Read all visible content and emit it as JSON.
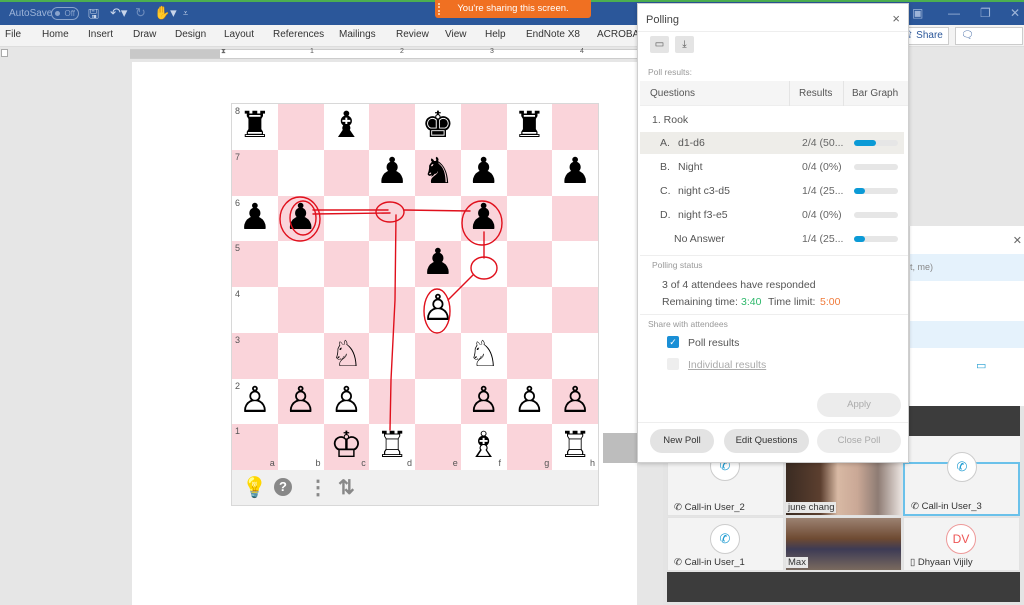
{
  "titlebar": {
    "autosave_label": "AutoSave",
    "autosave_state": "Off",
    "quick_access_icons": [
      "save-icon",
      "undo-icon",
      "redo-icon",
      "touch-mode-icon",
      "customize-icon"
    ],
    "sharing_banner": "You're sharing this screen.",
    "window_buttons": [
      "ribbon-display-icon",
      "minimize-icon",
      "restore-icon",
      "close-icon"
    ]
  },
  "ribbon": {
    "tabs": [
      "File",
      "Home",
      "Insert",
      "Draw",
      "Design",
      "Layout",
      "References",
      "Mailings",
      "Review",
      "View",
      "Help",
      "EndNote X8",
      "ACROBAT"
    ],
    "share_label": "Share",
    "comments_label": "Comments"
  },
  "ruler": {
    "numbers": [
      "1",
      "1",
      "2",
      "3",
      "4"
    ]
  },
  "chessboard": {
    "ranks": [
      "8",
      "7",
      "6",
      "5",
      "4",
      "3",
      "2",
      "1"
    ],
    "files": [
      "a",
      "b",
      "c",
      "d",
      "e",
      "f",
      "g",
      "h"
    ],
    "pieces": [
      {
        "square": "a8",
        "glyph": "♜",
        "name": "black-rook"
      },
      {
        "square": "c8",
        "glyph": "♝",
        "name": "black-bishop"
      },
      {
        "square": "e8",
        "glyph": "♚",
        "name": "black-king"
      },
      {
        "square": "g8",
        "glyph": "♜",
        "name": "black-rook"
      },
      {
        "square": "d7",
        "glyph": "♟",
        "name": "black-pawn"
      },
      {
        "square": "e7",
        "glyph": "♞",
        "name": "black-knight"
      },
      {
        "square": "f7",
        "glyph": "♟",
        "name": "black-pawn"
      },
      {
        "square": "h7",
        "glyph": "♟",
        "name": "black-pawn"
      },
      {
        "square": "a6",
        "glyph": "♟",
        "name": "black-pawn"
      },
      {
        "square": "b6",
        "glyph": "♟",
        "name": "black-pawn"
      },
      {
        "square": "f6",
        "glyph": "♟",
        "name": "black-pawn"
      },
      {
        "square": "e5",
        "glyph": "♟",
        "name": "black-pawn"
      },
      {
        "square": "e4",
        "glyph": "♙",
        "name": "white-pawn"
      },
      {
        "square": "c3",
        "glyph": "♘",
        "name": "white-knight"
      },
      {
        "square": "f3",
        "glyph": "♘",
        "name": "white-knight"
      },
      {
        "square": "a2",
        "glyph": "♙",
        "name": "white-pawn"
      },
      {
        "square": "b2",
        "glyph": "♙",
        "name": "white-pawn"
      },
      {
        "square": "c2",
        "glyph": "♙",
        "name": "white-pawn"
      },
      {
        "square": "f2",
        "glyph": "♙",
        "name": "white-pawn"
      },
      {
        "square": "g2",
        "glyph": "♙",
        "name": "white-pawn"
      },
      {
        "square": "h2",
        "glyph": "♙",
        "name": "white-pawn"
      },
      {
        "square": "c1",
        "glyph": "♔",
        "name": "white-king"
      },
      {
        "square": "d1",
        "glyph": "♖",
        "name": "white-rook"
      },
      {
        "square": "f1",
        "glyph": "♗",
        "name": "white-bishop"
      },
      {
        "square": "h1",
        "glyph": "♖",
        "name": "white-rook"
      }
    ],
    "toolbar_icons": [
      "hint-bulb-icon",
      "help-icon",
      "more-icon",
      "flip-board-icon"
    ],
    "annotation_color": "#e0101c"
  },
  "polling": {
    "title": "Polling",
    "toolbar_icons": [
      "open-poll-icon",
      "save-poll-icon"
    ],
    "results_label": "Poll results:",
    "columns": [
      "Questions",
      "Results",
      "Bar Graph"
    ],
    "question": "1.  Rook",
    "options": [
      {
        "letter": "A.",
        "text": "d1-d6",
        "result": "2/4 (50...",
        "fraction": 0.5
      },
      {
        "letter": "B.",
        "text": "Night",
        "result": "0/4 (0%)",
        "fraction": 0
      },
      {
        "letter": "C.",
        "text": "night c3-d5",
        "result": "1/4 (25...",
        "fraction": 0.25
      },
      {
        "letter": "D.",
        "text": "night f3-e5",
        "result": "0/4 (0%)",
        "fraction": 0
      },
      {
        "letter": "",
        "text": "No Answer",
        "result": "1/4 (25...",
        "fraction": 0.25
      }
    ],
    "status_label": "Polling status",
    "responded": "3  of  4  attendees have responded",
    "remaining_label": "Remaining time:",
    "remaining_value": "3:40",
    "limit_label": "Time limit:",
    "limit_value": "5:00",
    "share_label": "Share with attendees",
    "share_options": [
      {
        "label": "Poll results",
        "checked": true,
        "enabled": true
      },
      {
        "label": "Individual results",
        "checked": false,
        "enabled": false
      }
    ],
    "apply_label": "Apply",
    "new_poll_label": "New Poll",
    "edit_questions_label": "Edit Questions",
    "close_poll_label": "Close Poll",
    "colors": {
      "accent": "#0b9ad6",
      "remaining": "#2eb86b",
      "limit": "#f07a3a"
    }
  },
  "participants_panel": {
    "partial_text": "t, me)"
  },
  "video": {
    "tiles": [
      {
        "name": "Call-in User_2",
        "type": "phone"
      },
      {
        "name": "june chang",
        "type": "camera"
      },
      {
        "name": "Call-in User_3",
        "type": "phone"
      },
      {
        "name": "Call-in User_1",
        "type": "phone"
      },
      {
        "name": "Max",
        "type": "camera"
      },
      {
        "name": "Dhyaan Vijily",
        "type": "initials",
        "initials": "DV"
      }
    ]
  }
}
